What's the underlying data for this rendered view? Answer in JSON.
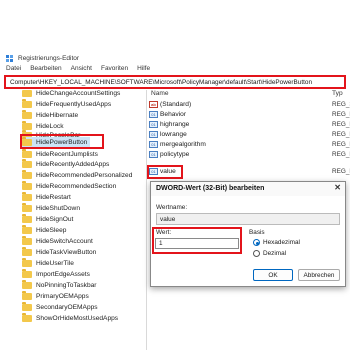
{
  "window": {
    "title": "Registrierungs-Editor",
    "address": "Computer\\HKEY_LOCAL_MACHINE\\SOFTWARE\\Microsoft\\PolicyManager\\default\\Start\\HidePowerButton"
  },
  "menu": [
    "Datei",
    "Bearbeiten",
    "Ansicht",
    "Favoriten",
    "Hilfe"
  ],
  "tree": {
    "items": [
      {
        "label": "HideChangeAccountSettings",
        "selected": false
      },
      {
        "label": "HideFrequentlyUsedApps",
        "selected": false
      },
      {
        "label": "HideHibernate",
        "selected": false
      },
      {
        "label": "HideLock",
        "selected": false
      },
      {
        "label": "HidePeopleBar",
        "selected": false
      },
      {
        "label": "HidePowerButton",
        "selected": true
      },
      {
        "label": "HideRecentJumplists",
        "selected": false
      },
      {
        "label": "HideRecentlyAddedApps",
        "selected": false
      },
      {
        "label": "HideRecommendedPersonalized",
        "selected": false
      },
      {
        "label": "HideRecommendedSection",
        "selected": false
      },
      {
        "label": "HideRestart",
        "selected": false
      },
      {
        "label": "HideShutDown",
        "selected": false
      },
      {
        "label": "HideSignOut",
        "selected": false
      },
      {
        "label": "HideSleep",
        "selected": false
      },
      {
        "label": "HideSwitchAccount",
        "selected": false
      },
      {
        "label": "HideTaskViewButton",
        "selected": false
      },
      {
        "label": "HideUserTile",
        "selected": false
      },
      {
        "label": "ImportEdgeAssets",
        "selected": false
      },
      {
        "label": "NoPinningToTaskbar",
        "selected": false
      },
      {
        "label": "PrimaryOEMApps",
        "selected": false
      },
      {
        "label": "SecondaryOEMApps",
        "selected": false
      },
      {
        "label": "ShowOrHideMostUsedApps",
        "selected": false
      }
    ]
  },
  "values": {
    "headers": {
      "name": "Name",
      "type": "Typ"
    },
    "rows": [
      {
        "icon": "ab",
        "name": "(Standard)",
        "type": "REG_SZ"
      },
      {
        "icon": "dword",
        "name": "Behavior",
        "type": "REG_DW"
      },
      {
        "icon": "dword",
        "name": "highrange",
        "type": "REG_DW"
      },
      {
        "icon": "dword",
        "name": "lowrange",
        "type": "REG_DW"
      },
      {
        "icon": "dword",
        "name": "mergealgorithm",
        "type": "REG_DW"
      },
      {
        "icon": "dword",
        "name": "policytype",
        "type": "REG_DW"
      },
      {
        "icon": "dword",
        "name": "value",
        "type": "REG_DW"
      }
    ]
  },
  "dialog": {
    "title": "DWORD-Wert (32-Bit) bearbeiten",
    "close": "✕",
    "name_label": "Wertname:",
    "name_value": "value",
    "data_label": "Wert:",
    "data_value": "1",
    "base_label": "Basis",
    "hex_label": "Hexadezimal",
    "dec_label": "Dezimal",
    "base_selected": "Hexadezimal",
    "ok": "OK",
    "cancel": "Abbrechen"
  },
  "colors": {
    "highlight": "#e3141b",
    "selection": "#cce4f7",
    "folder": "#f3c84b"
  }
}
